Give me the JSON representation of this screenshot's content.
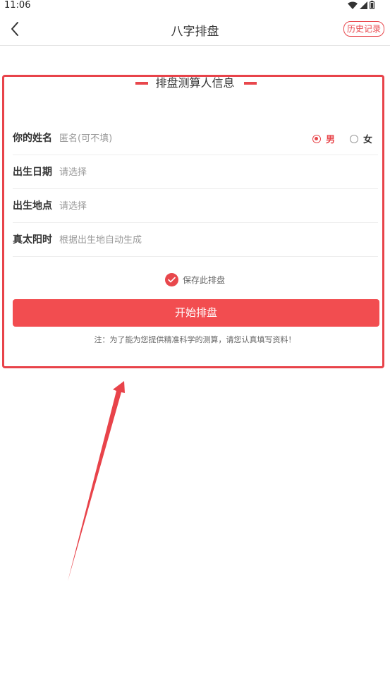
{
  "status_bar": {
    "time": "11:06"
  },
  "nav": {
    "title": "八字排盘",
    "history_label": "历史记录"
  },
  "section": {
    "title": "排盘测算人信息"
  },
  "form": {
    "name": {
      "label": "你的姓名",
      "placeholder": "匿名(可不填)"
    },
    "gender": {
      "male": "男",
      "female": "女",
      "selected": "男"
    },
    "birth_date": {
      "label": "出生日期",
      "placeholder": "请选择"
    },
    "birth_place": {
      "label": "出生地点",
      "placeholder": "请选择"
    },
    "solar_time": {
      "label": "真太阳时",
      "placeholder": "根据出生地自动生成"
    },
    "save_label": "保存此排盘",
    "save_checked": true,
    "submit_label": "开始排盘",
    "note": "注：为了能为您提供精准科学的测算，请您认真填写资料！"
  },
  "colors": {
    "accent": "#e8474c",
    "button": "#f24d50",
    "annotation": "#e8434a"
  },
  "icons": {
    "back": "back-arrow-icon",
    "wifi": "wifi-icon",
    "signal": "signal-icon",
    "battery": "battery-icon",
    "check": "check-icon"
  }
}
